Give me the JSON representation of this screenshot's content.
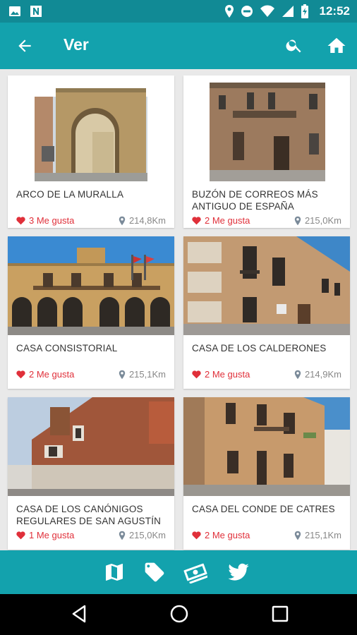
{
  "status_bar": {
    "time": "12:52",
    "icons": [
      "image-icon",
      "n-icon",
      "location-icon",
      "do-not-disturb-icon",
      "wifi-icon",
      "signal-icon",
      "battery-charging-icon"
    ]
  },
  "app_bar": {
    "title": "Ver",
    "back_icon": "arrow-back-icon",
    "search_icon": "search-icon",
    "home_icon": "home-icon"
  },
  "cards": [
    {
      "name": "ARCO DE LA MURALLA",
      "likes": "3 Me gusta",
      "distance": "214,8Km"
    },
    {
      "name": "BUZÓN DE CORREOS MÁS ANTIGUO DE ESPAÑA",
      "likes": "2 Me gusta",
      "distance": "215,0Km"
    },
    {
      "name": "CASA CONSISTORIAL",
      "likes": "2 Me gusta",
      "distance": "215,1Km"
    },
    {
      "name": "CASA DE LOS CALDERONES",
      "likes": "2 Me gusta",
      "distance": "214,9Km"
    },
    {
      "name": "CASA DE LOS CANÓNIGOS REGULARES DE SAN AGUSTÍN",
      "likes": "1 Me gusta",
      "distance": "215,0Km"
    },
    {
      "name": "CASA DEL CONDE DE CATRES",
      "likes": "2 Me gusta",
      "distance": "215,1Km"
    }
  ],
  "bottom_bar": {
    "icons": [
      "map-icon",
      "tag-icon",
      "money-icon",
      "twitter-icon"
    ]
  },
  "nav_bar": {
    "icons": [
      "nav-back-icon",
      "nav-home-icon",
      "nav-recents-icon"
    ]
  },
  "colors": {
    "primary": "#13a2ad",
    "primary_dark": "#118a95",
    "like_red": "#e0303a",
    "distance_grey": "#888888"
  }
}
